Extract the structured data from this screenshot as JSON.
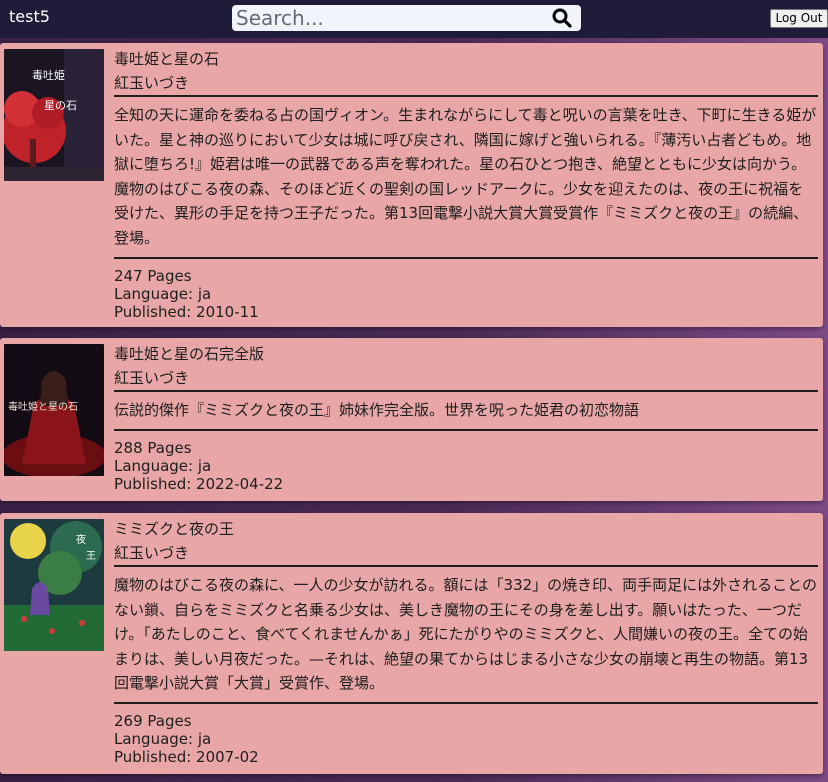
{
  "header": {
    "username": "test5",
    "search_placeholder": "Search...",
    "logout_label": "Log Out"
  },
  "books": [
    {
      "title": "毒吐姫と星の石",
      "author": "紅玉いづき",
      "description": "全知の天に運命を委ねる占の国ヴィオン。生まれながらにして毒と呪いの言葉を吐き、下町に生きる姫がいた。星と神の巡りにおいて少女は城に呼び戻され、隣国に嫁げと強いられる。『薄汚い占者どもめ。地獄に堕ちろ!』姫君は唯一の武器である声を奪われた。星の石ひとつ抱き、絶望とともに少女は向かう。魔物のはびこる夜の森、そのほど近くの聖剣の国レッドアークに。少女を迎えたのは、夜の王に祝福を受けた、異形の手足を持つ王子だった。第13回電撃小説大賞大賞受賞作『ミミズクと夜の王』の続編、登場。",
      "pages": "247 Pages",
      "language": "Language: ja",
      "published": "Published: 2010-11"
    },
    {
      "title": "毒吐姫と星の石完全版",
      "author": "紅玉いづき",
      "description": "伝説的傑作『ミミズクと夜の王』姉妹作完全版。世界を呪った姫君の初恋物語",
      "pages": "288 Pages",
      "language": "Language: ja",
      "published": "Published: 2022-04-22"
    },
    {
      "title": "ミミズクと夜の王",
      "author": "紅玉いづき",
      "description": "魔物のはびこる夜の森に、一人の少女が訪れる。額には「332」の焼き印、両手両足には外されることのない鎖、自らをミミズクと名乗る少女は、美しき魔物の王にその身を差し出す。願いはたった、一つだけ。「あたしのこと、食べてくれませんかぁ」死にたがりやのミミズクと、人間嫌いの夜の王。全ての始まりは、美しい月夜だった。—それは、絶望の果てからはじまる小さな少女の崩壊と再生の物語。第13回電撃小説大賞「大賞」受賞作、登場。",
      "pages": "269 Pages",
      "language": "Language: ja",
      "published": "Published: 2007-02"
    }
  ]
}
